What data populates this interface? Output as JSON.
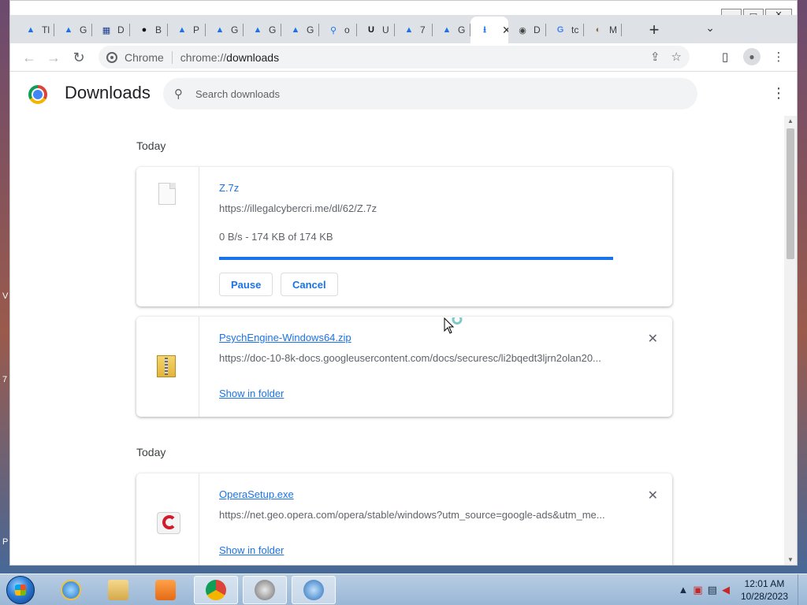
{
  "desktop": {
    "fragments": [
      "V",
      "7",
      "P"
    ]
  },
  "window": {
    "controls": {
      "minimize": "▁",
      "maximize": "▭",
      "close": "✕"
    },
    "tabs": [
      {
        "favicon": "google-drive-icon",
        "label": "Tl",
        "color": "#1a73e8"
      },
      {
        "favicon": "google-drive-icon",
        "label": "G",
        "color": "#1a73e8"
      },
      {
        "favicon": "vmware-icon",
        "label": "D",
        "color": "#1f3f8f"
      },
      {
        "favicon": "github-icon",
        "label": "B",
        "color": "#111111"
      },
      {
        "favicon": "google-drive-icon",
        "label": "P",
        "color": "#1a73e8"
      },
      {
        "favicon": "google-drive-icon",
        "label": "G",
        "color": "#1a73e8"
      },
      {
        "favicon": "google-drive-icon",
        "label": "G",
        "color": "#1a73e8"
      },
      {
        "favicon": "google-drive-icon",
        "label": "G",
        "color": "#1a73e8"
      },
      {
        "favicon": "search-icon",
        "label": "o",
        "color": "#1a73e8"
      },
      {
        "favicon": "uptodown-icon",
        "label": "U",
        "color": "#111111"
      },
      {
        "favicon": "google-drive-icon",
        "label": "7",
        "color": "#1a73e8"
      },
      {
        "favicon": "google-drive-icon",
        "label": "G",
        "color": "#1a73e8"
      },
      {
        "favicon": "download-icon",
        "label": "",
        "color": "#1a73e8",
        "active": true
      },
      {
        "favicon": "steam-icon",
        "label": "D",
        "color": "#444444"
      },
      {
        "favicon": "google-icon",
        "label": "tc",
        "color": "#4285f4"
      },
      {
        "favicon": "app-icon",
        "label": "M",
        "color": "#8a6a4a"
      }
    ],
    "new_tab": "+",
    "tab_search": "⌄",
    "toolbar": {
      "back": "←",
      "forward": "→",
      "reload": "↻",
      "omnibox_scheme": "Chrome",
      "omnibox_url_prefix": "chrome://",
      "omnibox_url_host": "downloads",
      "share": "⇪",
      "bookmark": "☆",
      "sidepanel": "▯",
      "profile": "●",
      "menu": "⋮"
    }
  },
  "downloads": {
    "title": "Downloads",
    "search_placeholder": "Search downloads",
    "menu": "⋮",
    "groups": [
      {
        "date": "Today"
      },
      {
        "date": "Today"
      }
    ],
    "items": [
      {
        "name": "Z.7z",
        "url": "https://illegalcybercri.me/dl/62/Z.7z",
        "status": "0 B/s - 174 KB of 174 KB",
        "progress": 1.0,
        "actions": {
          "pause": "Pause",
          "cancel": "Cancel"
        }
      },
      {
        "name": "PsychEngine-Windows64.zip",
        "url": "https://doc-10-8k-docs.googleusercontent.com/docs/securesc/li2bqedt3ljrn2olan20...",
        "show_in_folder": "Show in folder",
        "remove": "✕"
      },
      {
        "name": "OperaSetup.exe",
        "url": "https://net.geo.opera.com/opera/stable/windows?utm_source=google-ads&utm_me...",
        "show_in_folder": "Show in folder",
        "remove": "✕"
      }
    ]
  },
  "taskbar": {
    "apps": [
      "internet-explorer-icon",
      "file-explorer-icon",
      "media-player-icon",
      "chrome-icon",
      "app-icon",
      "app-icon"
    ],
    "tray": {
      "chevron": "▲",
      "icons": [
        "network-icon",
        "battery-icon",
        "volume-muted-icon"
      ]
    },
    "clock": {
      "time": "12:01 AM",
      "date": "10/28/2023"
    }
  },
  "colors": {
    "accent": "#1a73e8",
    "progress": "#1a73e8",
    "link": "#1a73e8"
  }
}
